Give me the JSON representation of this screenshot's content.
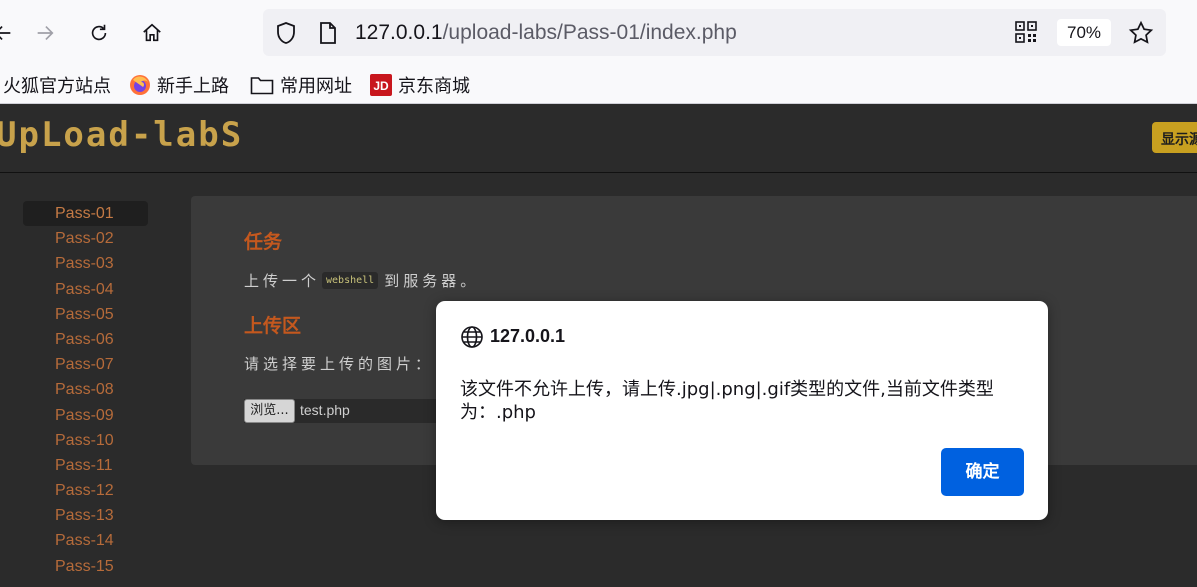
{
  "browser": {
    "url_host": "127.0.0.1",
    "url_path": "/upload-labs/Pass-01/index.php",
    "zoom": "70%"
  },
  "bookmarks": [
    {
      "label": "火狐官方站点",
      "icon": "firefox-cn-icon"
    },
    {
      "label": "新手上路",
      "icon": "firefox-icon"
    },
    {
      "label": "常用网址",
      "icon": "folder-icon"
    },
    {
      "label": "京东商城",
      "icon": "jd-icon"
    }
  ],
  "site": {
    "logo": "UpLoad-labS",
    "show_source_label": "显示源"
  },
  "sidebar": {
    "items": [
      "Pass-01",
      "Pass-02",
      "Pass-03",
      "Pass-04",
      "Pass-05",
      "Pass-06",
      "Pass-07",
      "Pass-08",
      "Pass-09",
      "Pass-10",
      "Pass-11",
      "Pass-12",
      "Pass-13",
      "Pass-14",
      "Pass-15"
    ]
  },
  "main": {
    "task_heading": "任务",
    "task_prefix": "上传一个",
    "task_code": "webshell",
    "task_suffix": "到服务器。",
    "upload_heading": "上传区",
    "choose_label": "请选择要上传的图片：",
    "browse_label": "浏览...",
    "file_name": "test.php"
  },
  "dialog": {
    "title": "127.0.0.1",
    "message": "该文件不允许上传，请上传.jpg|.png|.gif类型的文件,当前文件类型为：.php",
    "ok_label": "确定"
  },
  "colors": {
    "accent_orange": "#c4581e",
    "link_brown": "#b66b3a",
    "button_blue": "#0061e0",
    "logo_gold": "#c8a24b"
  }
}
